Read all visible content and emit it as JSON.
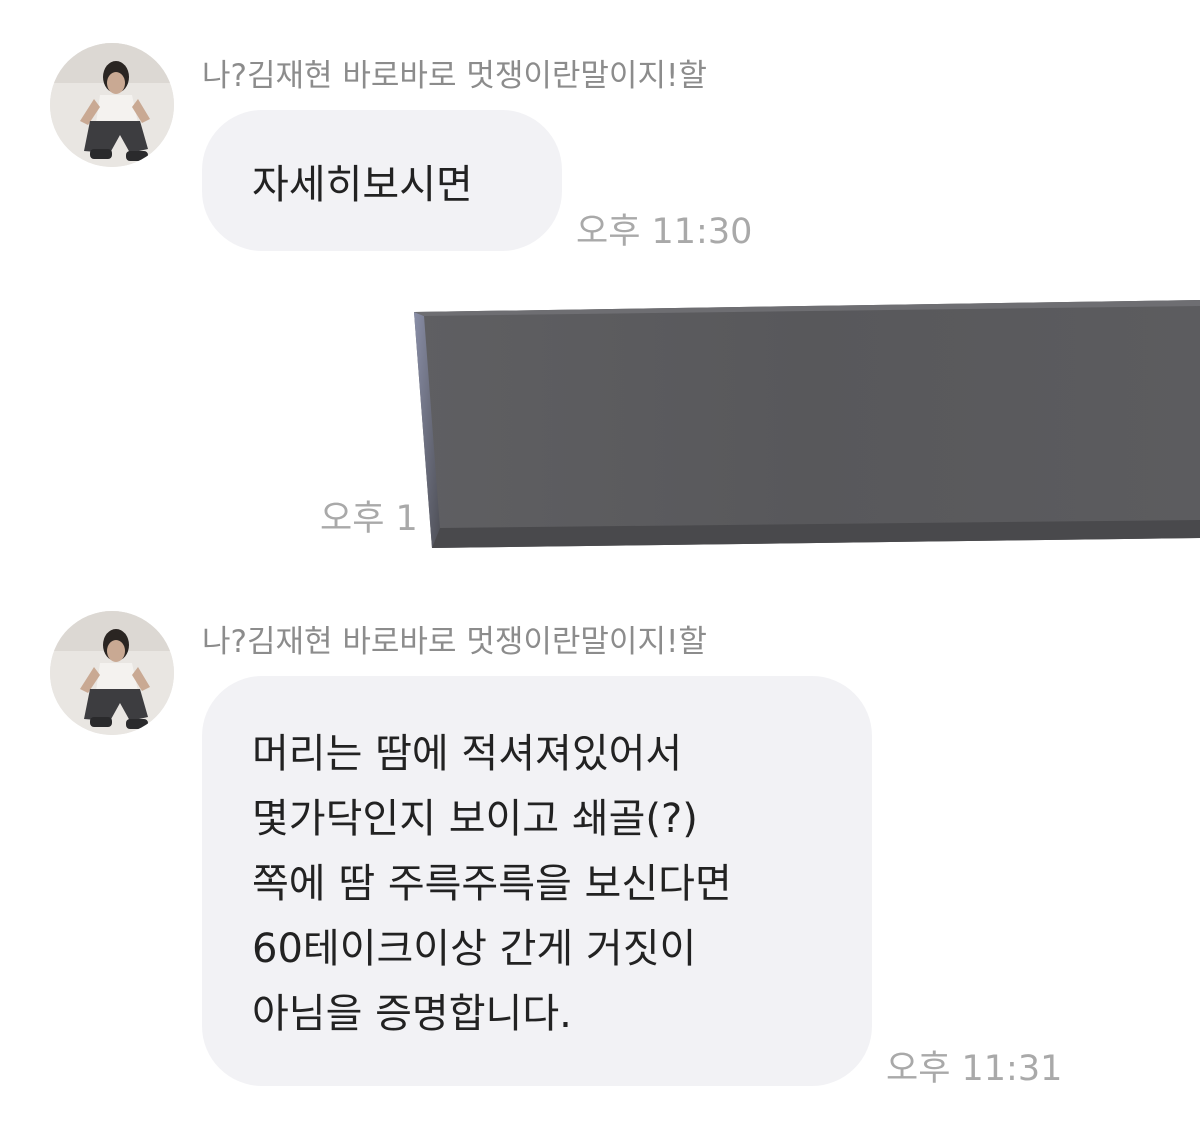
{
  "messages": [
    {
      "sender": "나?김재현 바로바로 멋쟁이란말이지!할",
      "text": "자세히보시면",
      "time": "오후 11:30"
    },
    {
      "image_alt": "",
      "time": "오후 1"
    },
    {
      "sender": "나?김재현 바로바로 멋쟁이란말이지!할",
      "text": "머리는 땀에 적셔져있어서\n몇가닥인지 보이고 쇄골(?)\n쪽에 땀 주륵주륵을 보신다면\n60테이크이상 간게 거짓이\n아님을 증명합니다.",
      "time": "오후 11:31"
    }
  ],
  "colors": {
    "bubble": "#f2f2f5",
    "text": "#222222",
    "sender": "#8c8c8c",
    "time": "#a9a9a9",
    "image_gray": "#5a5a5c"
  }
}
